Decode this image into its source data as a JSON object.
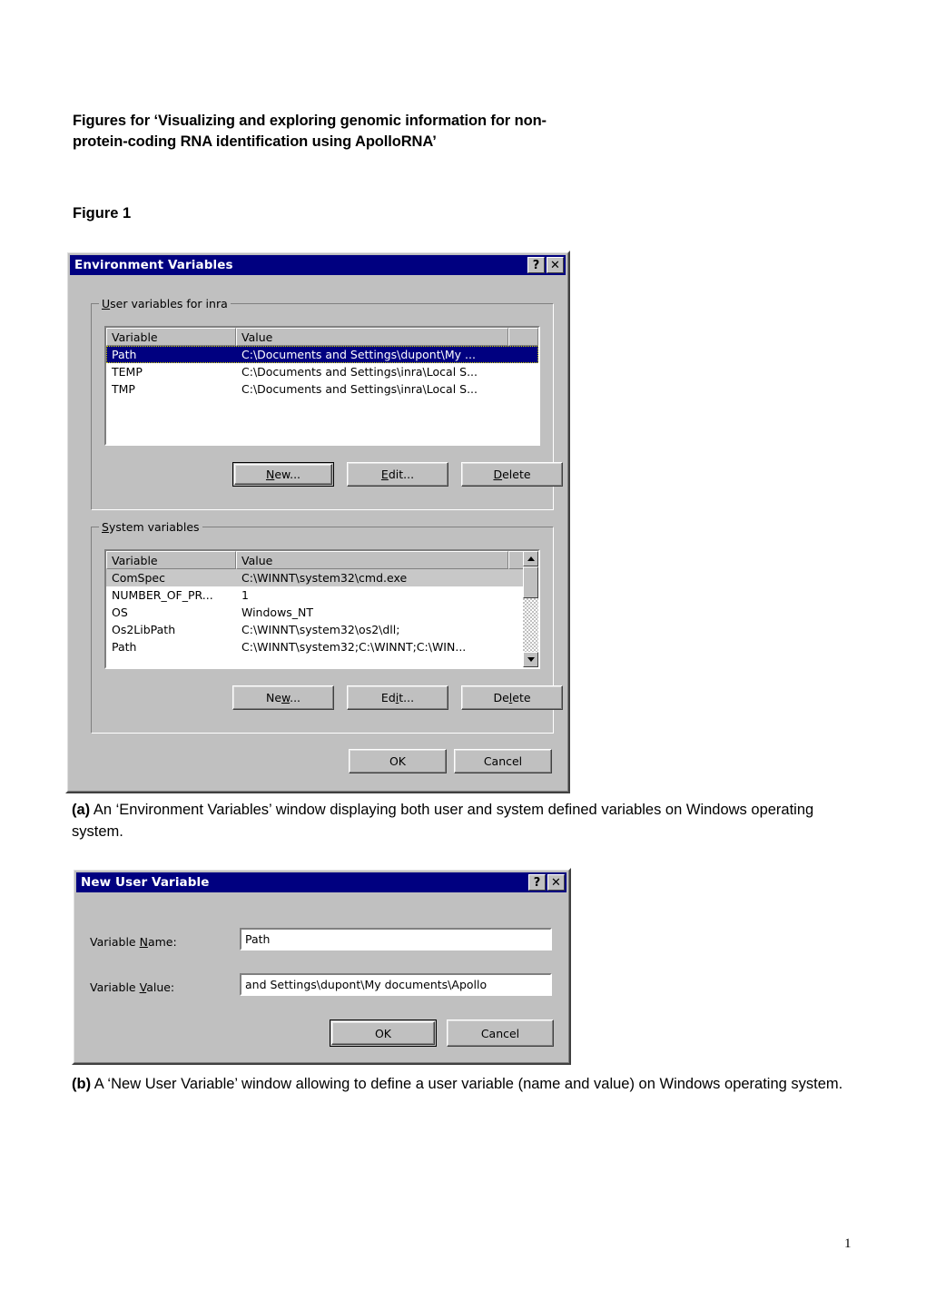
{
  "document": {
    "title_line1": "Figures for ‘Visualizing and exploring genomic information for non-",
    "title_line2": "protein-coding RNA identification using ApolloRNA’",
    "figure_label": "Figure 1",
    "caption_a_marker": "(a)",
    "caption_a_text": "  An ‘Environment Variables’ window displaying both user and system defined variables on Windows operating system.",
    "caption_b_marker": "(b)",
    "caption_b_text": "  A ‘New User Variable’ window allowing to define a user variable (name and value) on Windows operating system.",
    "page_number": "1"
  },
  "colors": {
    "titlebar": "#000080",
    "dialog_face": "#c0c0c0",
    "selection": "#000080",
    "selection_inactive": "#c8c8c8"
  },
  "dialog_env": {
    "title": "Environment Variables",
    "help_button": "?",
    "close_button": "✕",
    "user_group": {
      "legend_pre": "U",
      "legend_post": "ser variables for inra",
      "columns": [
        "Variable",
        "Value"
      ],
      "rows": [
        {
          "variable": "Path",
          "value": "C:\\Documents and Settings\\dupont\\My ...",
          "selected": true
        },
        {
          "variable": "TEMP",
          "value": "C:\\Documents and Settings\\inra\\Local S...",
          "selected": false
        },
        {
          "variable": "TMP",
          "value": "C:\\Documents and Settings\\inra\\Local S...",
          "selected": false
        }
      ],
      "buttons": [
        {
          "pre": "",
          "key": "N",
          "post": "ew...",
          "default": true
        },
        {
          "pre": "",
          "key": "E",
          "post": "dit...",
          "default": false
        },
        {
          "pre": "",
          "key": "D",
          "post": "elete",
          "default": false
        }
      ]
    },
    "system_group": {
      "legend_pre": "S",
      "legend_post": "ystem variables",
      "columns": [
        "Variable",
        "Value"
      ],
      "rows": [
        {
          "variable": "ComSpec",
          "value": "C:\\WINNT\\system32\\cmd.exe",
          "selected_inactive": true
        },
        {
          "variable": "NUMBER_OF_PR...",
          "value": "1",
          "selected_inactive": false
        },
        {
          "variable": "OS",
          "value": "Windows_NT",
          "selected_inactive": false
        },
        {
          "variable": "Os2LibPath",
          "value": "C:\\WINNT\\system32\\os2\\dll;",
          "selected_inactive": false
        },
        {
          "variable": "Path",
          "value": "C:\\WINNT\\system32;C:\\WINNT;C:\\WIN...",
          "selected_inactive": false
        }
      ],
      "buttons": [
        {
          "pre": "Ne",
          "key": "w",
          "post": "...",
          "default": false
        },
        {
          "pre": "Ed",
          "key": "i",
          "post": "t...",
          "default": false
        },
        {
          "pre": "De",
          "key": "l",
          "post": "ete",
          "default": false
        }
      ],
      "scrollbar": {
        "up_icon": "scroll-up-arrow",
        "down_icon": "scroll-down-arrow"
      }
    },
    "ok_label": "OK",
    "cancel_label": "Cancel"
  },
  "dialog_new_var": {
    "title": "New User Variable",
    "help_button": "?",
    "close_button": "✕",
    "name_label_pre": "Variable ",
    "name_label_key": "N",
    "name_label_post": "ame:",
    "name_value": "Path",
    "value_label_pre": "Variable ",
    "value_label_key": "V",
    "value_label_post": "alue:",
    "value_value": "and Settings\\dupont\\My documents\\Apollo",
    "ok_label": "OK",
    "cancel_label": "Cancel"
  }
}
